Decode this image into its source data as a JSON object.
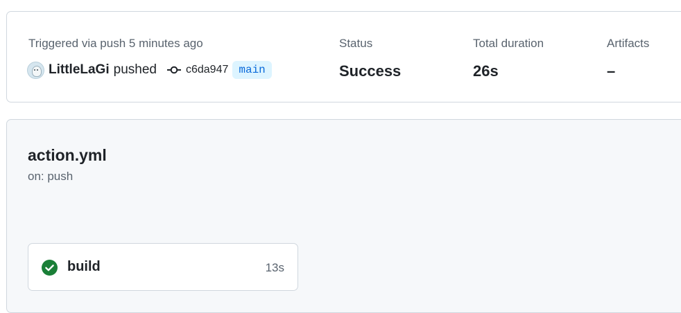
{
  "summary": {
    "trigger_label": "Triggered via push 5 minutes ago",
    "actor": "LittleLaGi",
    "action": "pushed",
    "commit_sha": "c6da947",
    "branch": "main",
    "status_label": "Status",
    "status_value": "Success",
    "duration_label": "Total duration",
    "duration_value": "26s",
    "artifacts_label": "Artifacts",
    "artifacts_value": "–"
  },
  "workflow": {
    "file": "action.yml",
    "trigger": "on: push"
  },
  "jobs": [
    {
      "name": "build",
      "duration": "13s",
      "status": "success",
      "status_color": "#1a7f37"
    }
  ],
  "icons": {
    "avatar": "user-avatar-icon",
    "commit": "git-commit-icon",
    "job_status": "check-circle-fill-icon"
  }
}
